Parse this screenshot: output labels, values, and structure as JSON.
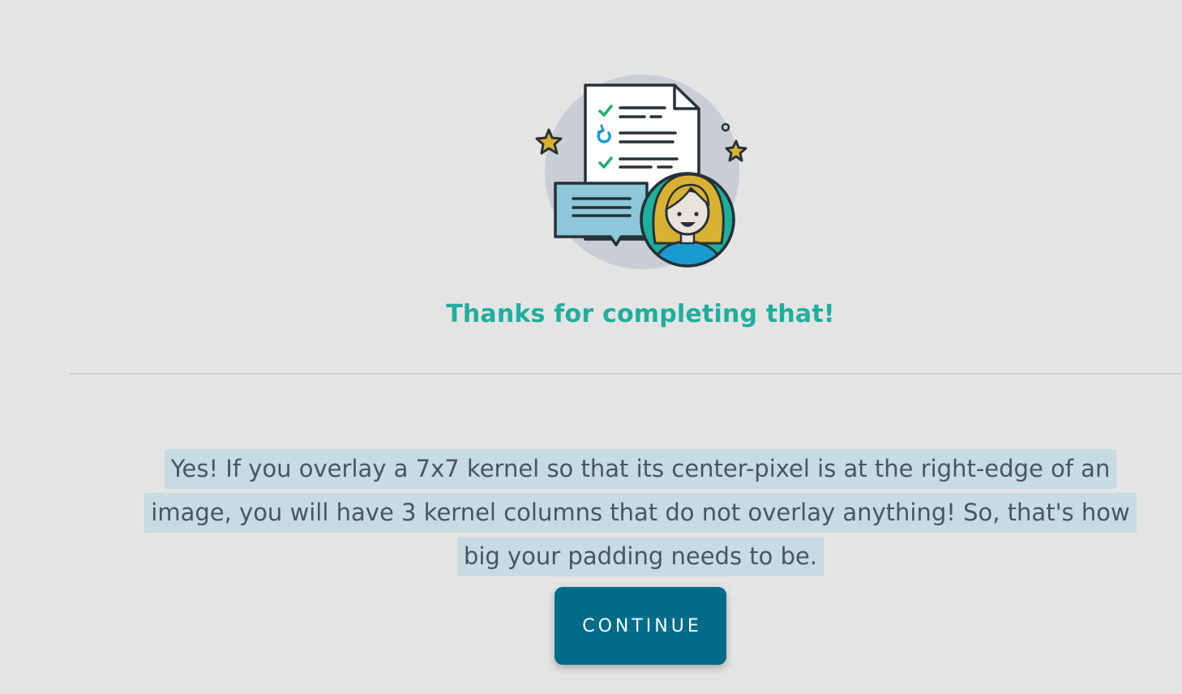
{
  "completion": {
    "title": "Thanks for completing that!",
    "message": "Yes! If you overlay a 7x7 kernel so that its center-pixel is at the right-edge of an image, you will have 3 kernel columns that do not overlay anything! So, that's how big your padding needs to be.",
    "continue_label": "CONTINUE"
  },
  "illustration": {
    "icons": [
      "document-checklist-icon",
      "speech-bubble-icon",
      "student-avatar-icon",
      "star-icon"
    ]
  },
  "colors": {
    "background": "#e4e4e4",
    "title": "#1eaf9d",
    "highlight": "#c7dbe2",
    "button": "#006c89",
    "text": "#4a5560"
  }
}
